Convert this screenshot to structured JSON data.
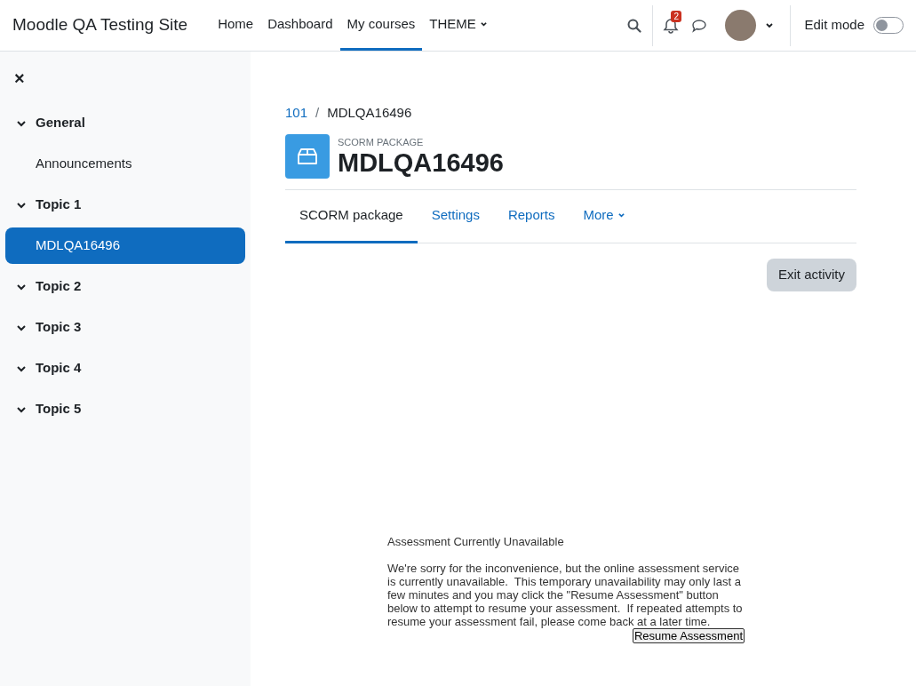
{
  "navbar": {
    "site_name": "Moodle QA Testing Site",
    "links": [
      {
        "label": "Home",
        "selected": false
      },
      {
        "label": "Dashboard",
        "selected": false
      },
      {
        "label": "My courses",
        "selected": true
      },
      {
        "label": "THEME",
        "selected": false,
        "dropdown": true
      }
    ],
    "notification_count": "2",
    "edit_mode": {
      "label": "Edit mode",
      "on": false
    }
  },
  "sidebar": {
    "close": "×",
    "items": [
      {
        "kind": "section",
        "label": "General",
        "expanded": true,
        "selected": false
      },
      {
        "kind": "activity",
        "label": "Announcements",
        "selected": false
      },
      {
        "kind": "section",
        "label": "Topic 1",
        "expanded": true,
        "selected": false
      },
      {
        "kind": "activity",
        "label": "MDLQA16496",
        "selected": true
      },
      {
        "kind": "section",
        "label": "Topic 2",
        "expanded": true,
        "selected": false
      },
      {
        "kind": "section",
        "label": "Topic 3",
        "expanded": true,
        "selected": false
      },
      {
        "kind": "section",
        "label": "Topic 4",
        "expanded": true,
        "selected": false
      },
      {
        "kind": "section",
        "label": "Topic 5",
        "expanded": true,
        "selected": false
      }
    ]
  },
  "breadcrumb": [
    "101",
    "MDLQA16496"
  ],
  "breadcrumb_separator": "/",
  "activity": {
    "type": "SCORM PACKAGE",
    "title": "MDLQA16496"
  },
  "tabs": [
    {
      "label": "SCORM package",
      "selected": true
    },
    {
      "label": "Settings",
      "selected": false
    },
    {
      "label": "Reports",
      "selected": false
    },
    {
      "label": "More",
      "selected": false,
      "dropdown": true
    }
  ],
  "exit_button": "Exit activity",
  "notice": {
    "heading": "Assessment Currently Unavailable",
    "message": "We're sorry for the inconvenience, but the online assessment service is currently unavailable.  This temporary unavailability may only last a few minutes and you may click the \"Resume Assessment\" button below to attempt to resume your assessment.  If repeated attempts to resume your assessment fail, please come back at a later time.",
    "button": "Resume Assessment"
  }
}
